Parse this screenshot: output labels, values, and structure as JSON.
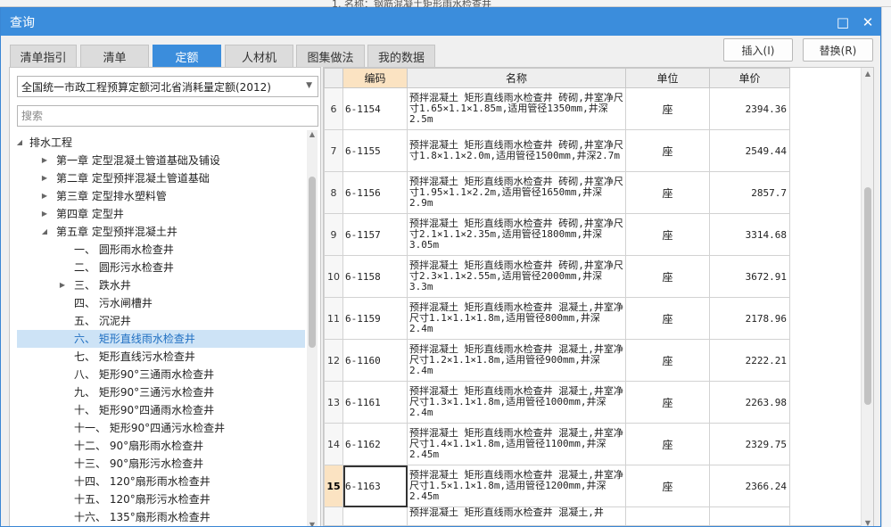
{
  "background": {
    "snippet": "1. 名称：钢筋混凝土矩形雨水检查井"
  },
  "window": {
    "title": "查询",
    "minimize": "□",
    "close": "✕"
  },
  "tabs": [
    "清单指引",
    "清单",
    "定额",
    "人材机",
    "图集做法",
    "我的数据"
  ],
  "active_tab": "定额",
  "buttons": {
    "insert": "插入(I)",
    "replace": "替换(R)"
  },
  "quota_select": "全国统一市政工程预算定额河北省消耗量定额(2012)",
  "search": {
    "placeholder": "搜索"
  },
  "tree": [
    {
      "label": "排水工程",
      "caret": "◢"
    },
    {
      "label": "第一章  定型混凝土管道基础及铺设",
      "caret": "▶"
    },
    {
      "label": "第二章  定型预拌混凝土管道基础",
      "caret": "▶"
    },
    {
      "label": "第三章  定型排水塑料管",
      "caret": "▶"
    },
    {
      "label": "第四章  定型井",
      "caret": "▶"
    },
    {
      "label": "第五章  定型预拌混凝土井",
      "caret": "◢"
    },
    {
      "label": "一、  圆形雨水检查井",
      "caret": ""
    },
    {
      "label": "二、  圆形污水检查井",
      "caret": ""
    },
    {
      "label": "三、  跌水井",
      "caret": "▶"
    },
    {
      "label": "四、  污水闸槽井",
      "caret": ""
    },
    {
      "label": "五、  沉泥井",
      "caret": ""
    },
    {
      "label": "六、  矩形直线雨水检查井",
      "caret": ""
    },
    {
      "label": "七、  矩形直线污水检查井",
      "caret": ""
    },
    {
      "label": "八、  矩形90°三通雨水检查井",
      "caret": ""
    },
    {
      "label": "九、  矩形90°三通污水检查井",
      "caret": ""
    },
    {
      "label": "十、  矩形90°四通雨水检查井",
      "caret": ""
    },
    {
      "label": "十一、  矩形90°四通污水检查井",
      "caret": ""
    },
    {
      "label": "十二、  90°扇形雨水检查井",
      "caret": ""
    },
    {
      "label": "十三、  90°扇形污水检查井",
      "caret": ""
    },
    {
      "label": "十四、  120°扇形雨水检查井",
      "caret": ""
    },
    {
      "label": "十五、  120°扇形污水检查井",
      "caret": ""
    },
    {
      "label": "十六、  135°扇形雨水检查井",
      "caret": ""
    },
    {
      "label": "十七、  135°扇形污水检查井",
      "caret": ""
    }
  ],
  "tree_selected": "六、  矩形直线雨水检查井",
  "table": {
    "headers": {
      "code": "编码",
      "name": "名称",
      "unit": "单位",
      "price": "单价"
    },
    "rows": [
      {
        "idx": "6",
        "code": "6-1154",
        "name": "预拌混凝土 矩形直线雨水检查井 砖砌,井室净尺寸1.65×1.1×1.85m,适用管径1350mm,井深2.5m",
        "unit": "座",
        "price": "2394.36"
      },
      {
        "idx": "7",
        "code": "6-1155",
        "name": "预拌混凝土 矩形直线雨水检查井 砖砌,井室净尺寸1.8×1.1×2.0m,适用管径1500mm,井深2.7m",
        "unit": "座",
        "price": "2549.44"
      },
      {
        "idx": "8",
        "code": "6-1156",
        "name": "预拌混凝土 矩形直线雨水检查井 砖砌,井室净尺寸1.95×1.1×2.2m,适用管径1650mm,井深2.9m",
        "unit": "座",
        "price": "2857.7"
      },
      {
        "idx": "9",
        "code": "6-1157",
        "name": "预拌混凝土 矩形直线雨水检查井 砖砌,井室净尺寸2.1×1.1×2.35m,适用管径1800mm,井深3.05m",
        "unit": "座",
        "price": "3314.68"
      },
      {
        "idx": "10",
        "code": "6-1158",
        "name": "预拌混凝土 矩形直线雨水检查井 砖砌,井室净尺寸2.3×1.1×2.55m,适用管径2000mm,井深3.3m",
        "unit": "座",
        "price": "3672.91"
      },
      {
        "idx": "11",
        "code": "6-1159",
        "name": "预拌混凝土 矩形直线雨水检查井 混凝土,井室净尺寸1.1×1.1×1.8m,适用管径800mm,井深2.4m",
        "unit": "座",
        "price": "2178.96"
      },
      {
        "idx": "12",
        "code": "6-1160",
        "name": "预拌混凝土 矩形直线雨水检查井 混凝土,井室净尺寸1.2×1.1×1.8m,适用管径900mm,井深2.4m",
        "unit": "座",
        "price": "2222.21"
      },
      {
        "idx": "13",
        "code": "6-1161",
        "name": "预拌混凝土 矩形直线雨水检查井 混凝土,井室净尺寸1.3×1.1×1.8m,适用管径1000mm,井深2.4m",
        "unit": "座",
        "price": "2263.98"
      },
      {
        "idx": "14",
        "code": "6-1162",
        "name": "预拌混凝土 矩形直线雨水检查井 混凝土,井室净尺寸1.4×1.1×1.8m,适用管径1100mm,井深2.45m",
        "unit": "座",
        "price": "2329.75"
      },
      {
        "idx": "15",
        "code": "6-1163",
        "name": "预拌混凝土 矩形直线雨水检查井 混凝土,井室净尺寸1.5×1.1×1.8m,适用管径1200mm,井深2.45m",
        "unit": "座",
        "price": "2366.24"
      },
      {
        "idx": "",
        "code": "",
        "name": "预拌混凝土 矩形直线雨水检查井 混凝土,井",
        "unit": "",
        "price": ""
      }
    ],
    "current_row": "15"
  },
  "colors": {
    "accent": "#3b8ddc",
    "selected_row": "#fbe3c2",
    "tree_selection": "#cde3f6"
  }
}
